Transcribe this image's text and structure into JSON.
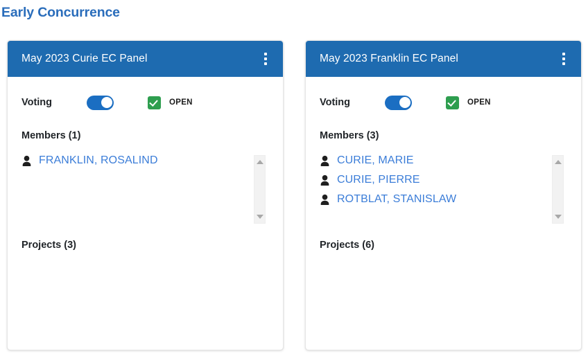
{
  "page": {
    "title": "Early Concurrence",
    "title_color": "#2a6dbb",
    "background": "#ffffff"
  },
  "theme": {
    "header_blue": "#1e6bb0",
    "toggle_blue": "#1b6ec2",
    "checkbox_green": "#2e9e4f",
    "link_blue": "#3b7dd8",
    "text_dark": "#212529",
    "card_border": "#e6e6e6",
    "scrollbar_track": "#f2f2f2",
    "scrollbar_arrow": "#a8a8a8"
  },
  "icons": {
    "kebab": "kebab-menu-icon",
    "person": "person-icon",
    "check": "check-icon",
    "scroll_up": "scroll-up-arrow-icon",
    "scroll_down": "scroll-down-arrow-icon"
  },
  "cards": [
    {
      "id": "curie-panel",
      "title": "May 2023 Curie EC Panel",
      "menu_label": "",
      "voting": {
        "label": "Voting",
        "toggle_on": true,
        "status_checked": true,
        "status_label": "OPEN"
      },
      "members": {
        "heading": "Members (1)",
        "count": 1,
        "list": [
          {
            "name": "FRANKLIN, ROSALIND"
          }
        ]
      },
      "projects": {
        "heading": "Projects (3)",
        "count": 3,
        "list": []
      }
    },
    {
      "id": "franklin-panel",
      "title": "May 2023 Franklin EC Panel",
      "menu_label": "",
      "voting": {
        "label": "Voting",
        "toggle_on": true,
        "status_checked": true,
        "status_label": "OPEN"
      },
      "members": {
        "heading": "Members (3)",
        "count": 3,
        "list": [
          {
            "name": "CURIE, MARIE"
          },
          {
            "name": "CURIE, PIERRE"
          },
          {
            "name": "ROTBLAT, STANISLAW"
          }
        ]
      },
      "projects": {
        "heading": "Projects (6)",
        "count": 6,
        "list": []
      }
    }
  ]
}
